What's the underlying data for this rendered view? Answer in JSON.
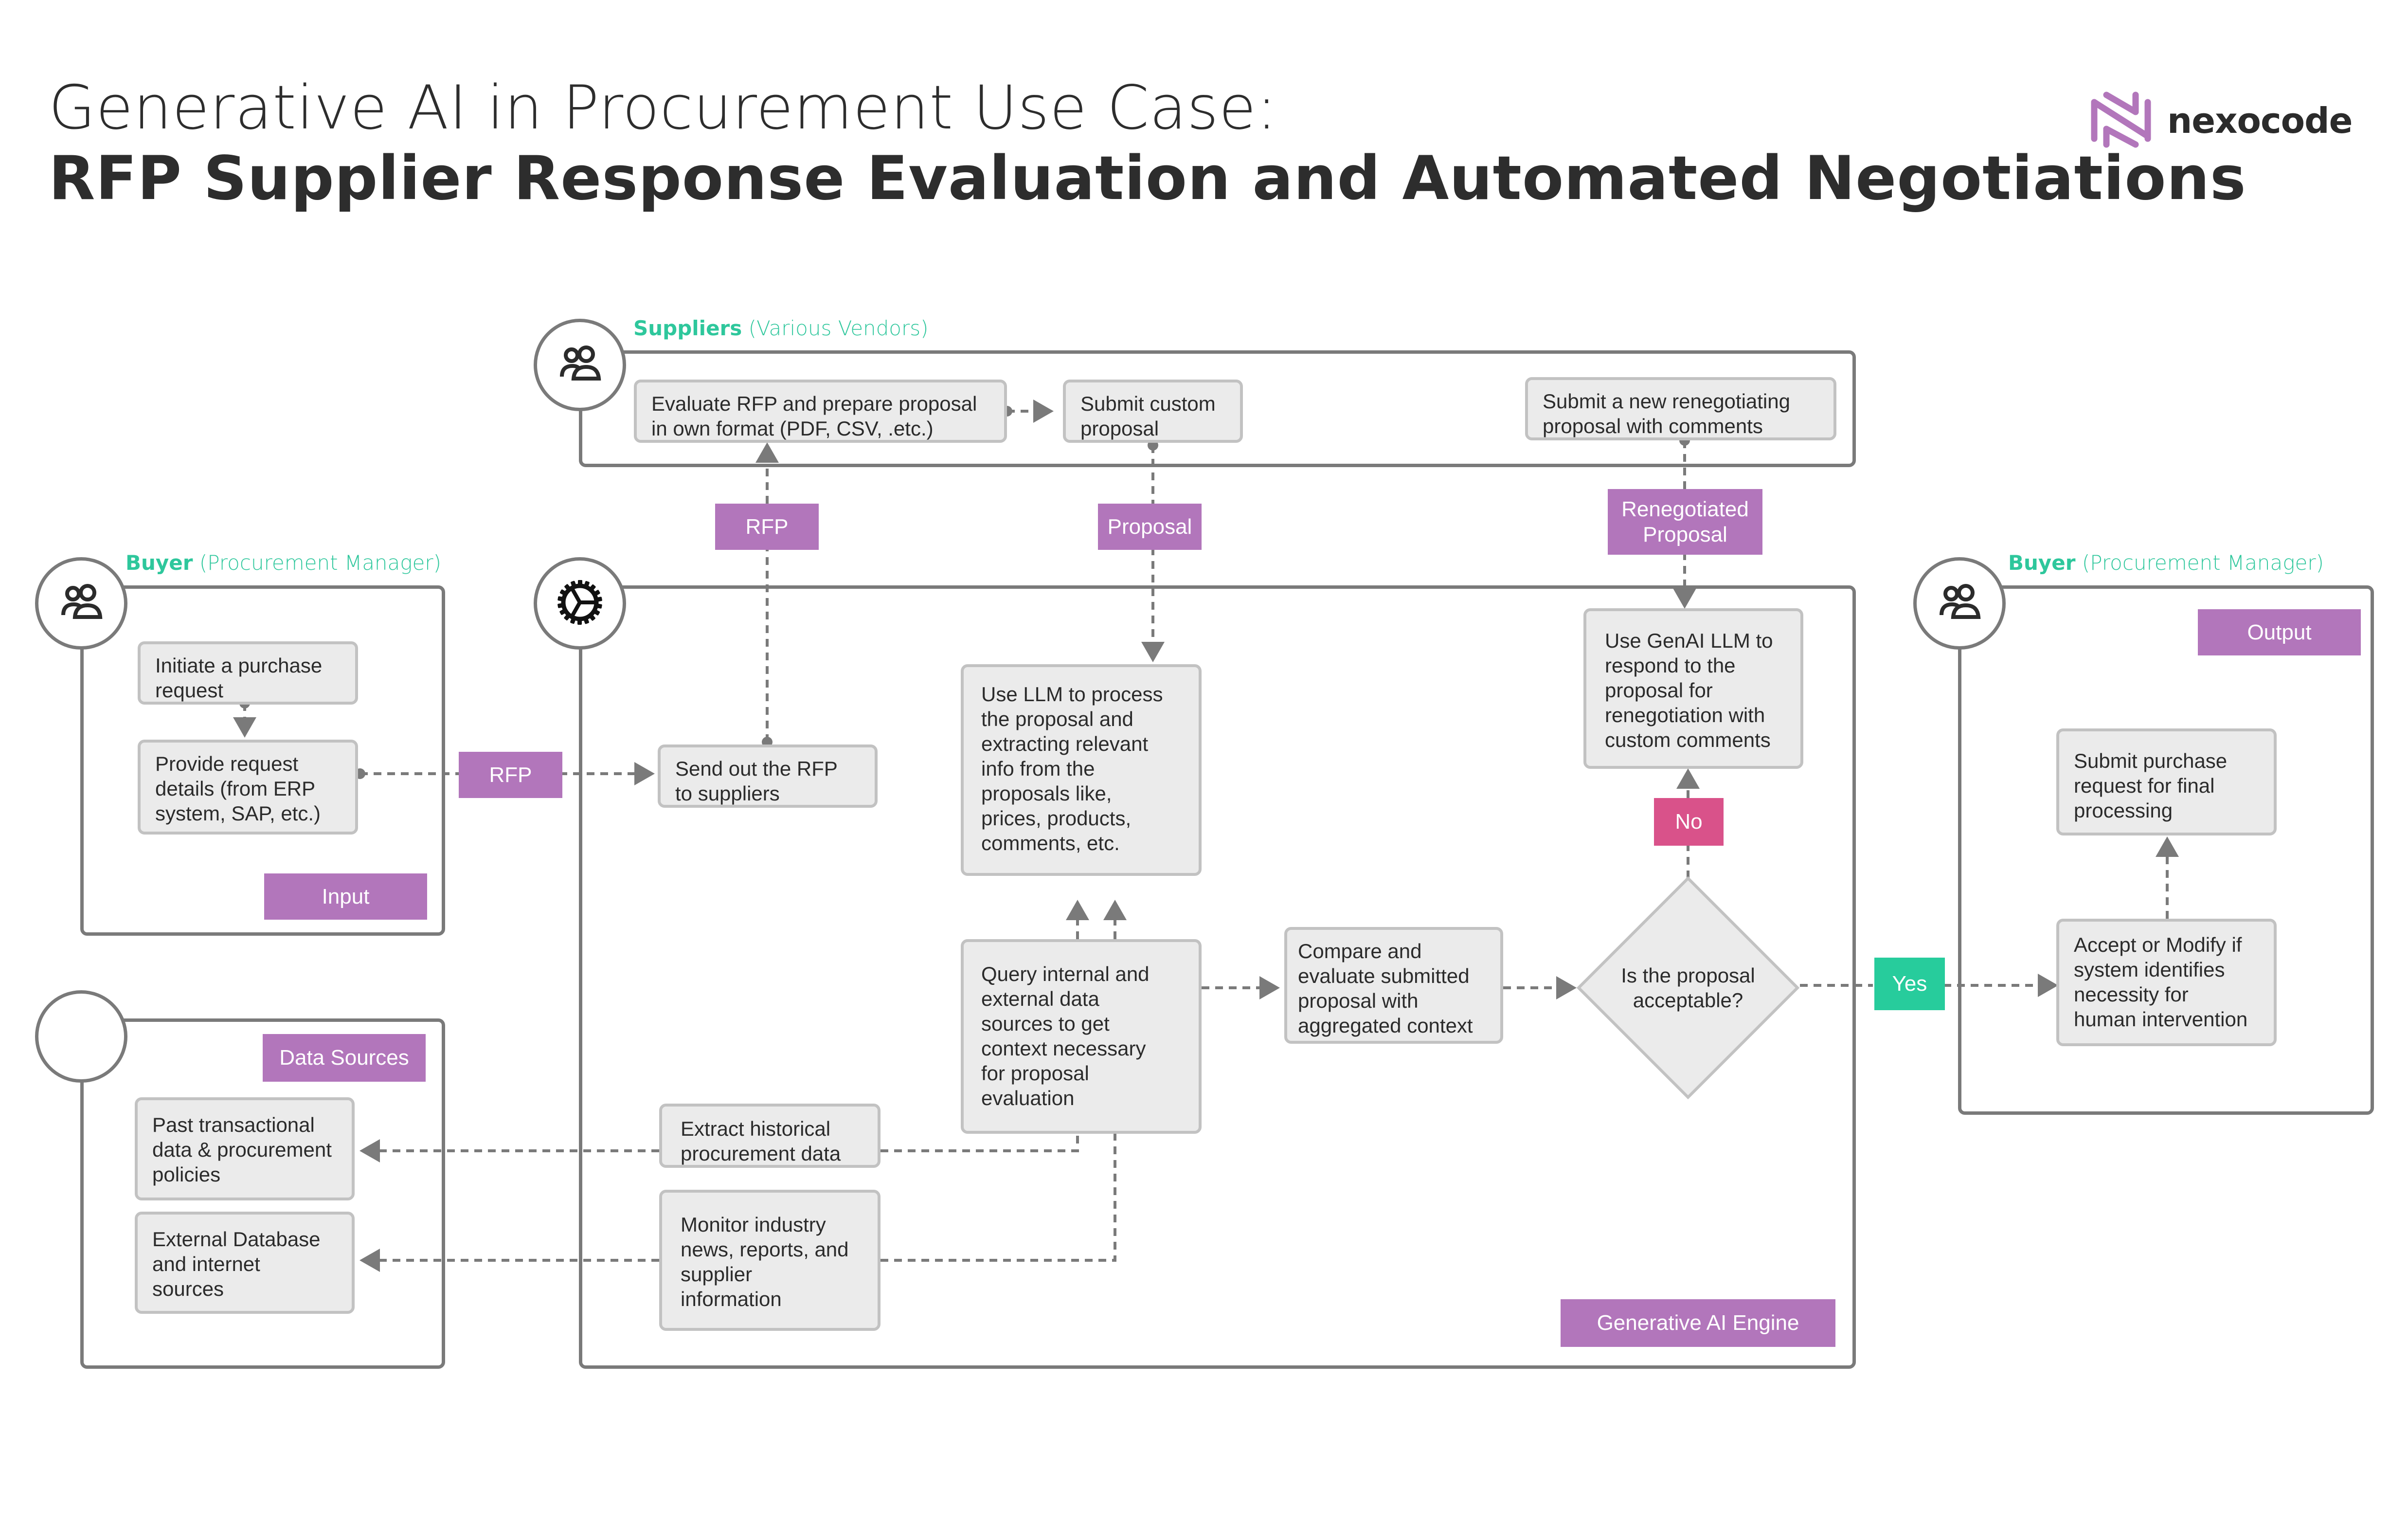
{
  "header": {
    "title_line1": "Generative AI in Procurement Use Case:",
    "title_line2": "RFP Supplier Response Evaluation and Automated Negotiations"
  },
  "logo": {
    "text": "nexocode",
    "icon": "nexocode-logo-icon",
    "color": "#b276bb"
  },
  "colors": {
    "tag_purple": "#b276bb",
    "tag_no": "#d9528a",
    "tag_yes": "#27cc9c",
    "lane_label": "#2ec79c",
    "node_fill": "#ebebeb",
    "connector": "#7a7a7a"
  },
  "lanes": {
    "suppliers": {
      "title": "Suppliers",
      "subtitle": "(Various Vendors)",
      "icon": "users-icon",
      "nodes": {
        "evaluate": "Evaluate RFP and prepare proposal\nin own format (PDF, CSV, .etc.)",
        "submit_custom": "Submit custom\nproposal",
        "submit_new": "Submit a new renegotiating\nproposal with comments"
      }
    },
    "buyer_input": {
      "title": "Buyer",
      "subtitle": "(Procurement Manager)",
      "icon": "users-icon",
      "tag": "Input",
      "nodes": {
        "initiate": "Initiate a purchase\nrequest",
        "provide": "Provide request\ndetails (from ERP\nsystem, SAP, etc.)"
      }
    },
    "engine": {
      "icon": "gear-icon",
      "tag": "Generative AI Engine",
      "nodes": {
        "send_rfp": "Send out the RFP\nto suppliers",
        "use_llm": "Use LLM to process\nthe proposal and\nextracting relevant\ninfo from the\nproposals like,\nprices, products,\ncomments, etc.",
        "query": "Query internal and\nexternal data\nsources to get\ncontext necessary\nfor proposal\nevaluation",
        "extract": "Extract historical\nprocurement data",
        "monitor": "Monitor industry\nnews, reports, and\nsupplier\ninformation",
        "compare": "Compare and\nevaluate submitted\nproposal with\naggregated context",
        "decision": "Is the proposal\nacceptable?",
        "genai_respond": "Use GenAI LLM to\nrespond to the\nproposal for\nrenegotiation with\ncustom comments"
      }
    },
    "data_sources": {
      "tag": "Data Sources",
      "nodes": {
        "past": "Past transactional\ndata & procurement\npolicies",
        "external": "External Database\nand internet\nsources"
      }
    },
    "buyer_output": {
      "title": "Buyer",
      "subtitle": "(Procurement Manager)",
      "icon": "users-icon",
      "tag": "Output",
      "nodes": {
        "submit_purchase": "Submit purchase\nrequest for final\nprocessing",
        "accept_modify": "Accept or Modify if\nsystem identifies\nnecessity for\nhuman intervention"
      }
    }
  },
  "connector_tags": {
    "rfp_left": "RFP",
    "rfp_up": "RFP",
    "proposal": "Proposal",
    "renegotiated": "Renegotiated\nProposal",
    "no": "No",
    "yes": "Yes"
  }
}
